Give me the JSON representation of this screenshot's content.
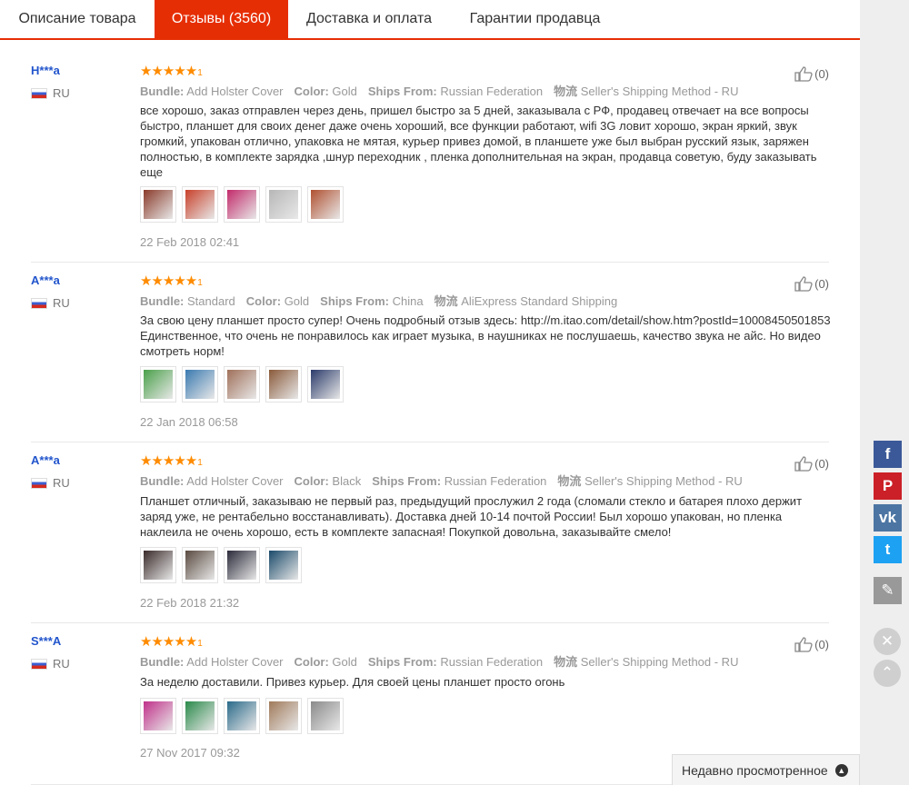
{
  "tabs": [
    {
      "label": "Описание товара",
      "active": false
    },
    {
      "label": "Отзывы (3560)",
      "active": true
    },
    {
      "label": "Доставка и оплата",
      "active": false
    },
    {
      "label": "Гарантии продавца",
      "active": false
    }
  ],
  "attribute_labels": {
    "bundle": "Bundle:",
    "color": "Color:",
    "ships_from": "Ships From:",
    "shipping": "物流"
  },
  "reviews": [
    {
      "user": "H***a",
      "country": "RU",
      "stars": "★★★★★",
      "rating": 5,
      "bundle": "Add Holster Cover",
      "color": "Gold",
      "ships_from": "Russian Federation",
      "shipping": "Seller's Shipping Method - RU",
      "text": "все хорошо, заказ отправлен через день, пришел быстро за 5 дней, заказывала с РФ, продавец отвечает на все вопросы быстро, планшет для своих денег даже очень хороший, все функции работают, wifi 3G ловит хорошо, экран яркий, звук громкий, упакован отлично, упаковка не мятая, курьер привез домой, в планшете уже был выбран русский язык, заряжен полностью, в комплекте зарядка ,шнур переходник , пленка дополнительная на экран, продавца советую, буду заказывать еще",
      "photos": [
        "#8a3a2a",
        "#c8402a",
        "#c22a6a",
        "#b7b7b7",
        "#b05030"
      ],
      "date": "22 Feb 2018 02:41",
      "likes": "(0)"
    },
    {
      "user": "A***a",
      "country": "RU",
      "stars": "★★★★★",
      "rating": 5,
      "bundle": "Standard",
      "color": "Gold",
      "ships_from": "China",
      "shipping": "AliExpress Standard Shipping",
      "text": "За свою цену планшет просто супер! Очень подробный отзыв здесь: http://m.itao.com/detail/show.htm?postId=10008450501853 Единственное, что очень не понравилось как играет музыка, в наушниках не послушаешь, качество звука не айс. Но видео смотреть норм!",
      "photos": [
        "#4aa04a",
        "#3a7ab0",
        "#a0705a",
        "#8a5a3a",
        "#2a3a6a"
      ],
      "date": "22 Jan 2018 06:58",
      "likes": "(0)"
    },
    {
      "user": "A***a",
      "country": "RU",
      "stars": "★★★★★",
      "rating": 5,
      "bundle": "Add Holster Cover",
      "color": "Black",
      "ships_from": "Russian Federation",
      "shipping": "Seller's Shipping Method - RU",
      "text": "Планшет отличный, заказываю не первый раз, предыдущий прослужил 2 года (сломали стекло и батарея плохо держит заряд уже, не рентабельно восстанавливать). Доставка дней 10-14 почтой России! Был хорошо упакован, но пленка наклеила не очень хорошо, есть в комплекте запасная! Покупкой довольна, заказывайте смело!",
      "photos": [
        "#3a2a2a",
        "#5a4a40",
        "#2a2a3a",
        "#1a4a6a"
      ],
      "date": "22 Feb 2018 21:32",
      "likes": "(0)"
    },
    {
      "user": "S***A",
      "country": "RU",
      "stars": "★★★★★",
      "rating": 5,
      "bundle": "Add Holster Cover",
      "color": "Gold",
      "ships_from": "Russian Federation",
      "shipping": "Seller's Shipping Method - RU",
      "text": "За неделю доставили. Привез курьер. Для своей цены планшет просто огонь",
      "photos": [
        "#c0308a",
        "#2a8a4a",
        "#2a6a8a",
        "#a07a5a",
        "#8a8a8a"
      ],
      "date": "27 Nov 2017 09:32",
      "likes": "(0)"
    }
  ],
  "share": [
    {
      "name": "facebook",
      "glyph": "f",
      "color": "#3b5998"
    },
    {
      "name": "pinterest",
      "glyph": "P",
      "color": "#cb2027"
    },
    {
      "name": "vk",
      "glyph": "vk",
      "color": "#4c75a3"
    },
    {
      "name": "twitter",
      "glyph": "t",
      "color": "#1da1f2"
    },
    {
      "name": "edit",
      "glyph": "✎",
      "color": "#999999"
    }
  ],
  "recently_viewed": "Недавно просмотренное"
}
